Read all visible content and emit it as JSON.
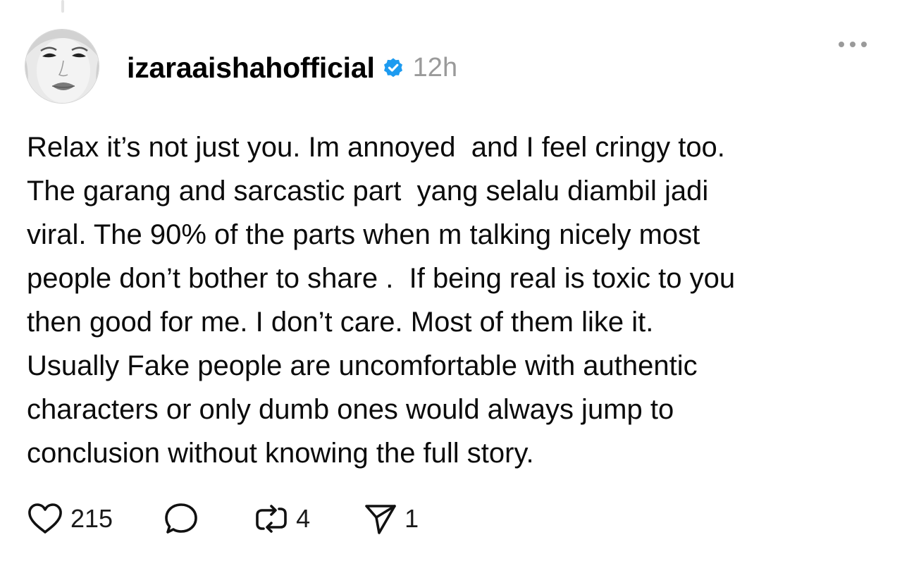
{
  "post": {
    "username": "izaraaishahofficial",
    "verified": true,
    "time": "12h",
    "icons": {
      "avatar": "profile-photo",
      "verified": "verified-badge-icon",
      "more": "more-options-icon"
    },
    "body_lines": [
      "Relax it’s not just you. Im annoyed  and I feel cringy too.",
      "The garang and sarcastic part  yang selalu diambil jadi",
      "viral. The 90% of the parts when m talking nicely most",
      "people don’t bother to share .  If being real is toxic to you",
      "then good for me. I don’t care. Most of them like it.",
      "Usually Fake people are uncomfortable with authentic",
      "characters or only dumb ones would always jump to",
      "conclusion without knowing the full story."
    ]
  },
  "actions": {
    "like": {
      "icon": "heart-icon",
      "count": "215"
    },
    "reply": {
      "icon": "comment-bubble-icon",
      "count": ""
    },
    "repost": {
      "icon": "repost-icon",
      "count": "4"
    },
    "share": {
      "icon": "send-icon",
      "count": "1"
    }
  },
  "colors": {
    "text": "#0b0b0b",
    "muted": "#9a9a9a",
    "verified": "#1d9bf0"
  }
}
